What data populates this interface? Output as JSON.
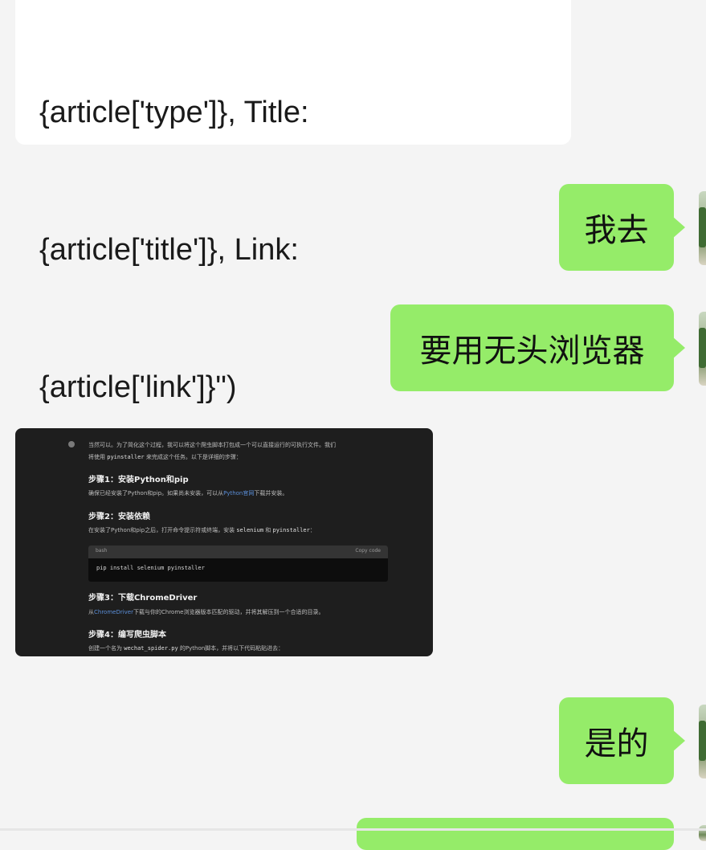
{
  "incoming_code_lines": [
    "{article['type']}, Title:",
    "{article['title']}, Link:",
    "{article['link']}\")"
  ],
  "messages": [
    {
      "text": "我去"
    },
    {
      "text": "要用无头浏览器"
    },
    {
      "text": "是的"
    }
  ],
  "screenshot": {
    "intro_line1": "当然可以。为了简化这个过程，我可以将这个爬虫脚本打包成一个可以直接运行的可执行文件。我们",
    "intro_line2_a": "将使用 ",
    "intro_line2_code": "pyinstaller",
    "intro_line2_b": " 来完成这个任务。以下是详细的步骤：",
    "step1_title": "步骤1：安装Python和pip",
    "step1_text_a": "确保已经安装了Python和pip。如果尚未安装，可以从",
    "step1_link": "Python官网",
    "step1_text_b": "下载并安装。",
    "step2_title": "步骤2：安装依赖",
    "step2_text_a": "在安装了Python和pip之后，打开命令提示符或终端，安装 ",
    "step2_code1": "selenium",
    "step2_text_b": " 和 ",
    "step2_code2": "pyinstaller",
    "step2_text_c": "：",
    "code_lang": "bash",
    "copy_label": "Copy code",
    "code_line": "pip install selenium pyinstaller",
    "step3_title": "步骤3：下载ChromeDriver",
    "step3_text_a": "从",
    "step3_link": "ChromeDriver",
    "step3_text_b": "下载与你的Chrome浏览器版本匹配的驱动，并将其解压到一个合适的目录。",
    "step4_title": "步骤4：编写爬虫脚本",
    "step4_text_a": "创建一个名为 ",
    "step4_code": "wechat_spider.py",
    "step4_text_b": " 的Python脚本，并将以下代码粘贴进去："
  }
}
